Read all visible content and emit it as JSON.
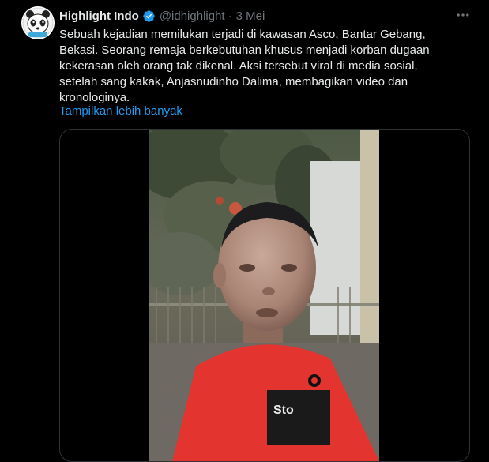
{
  "tweet": {
    "display_name": "Highlight Indo",
    "handle": "@idhighlight",
    "separator": "·",
    "date": "3 Mei",
    "text": "Sebuah kejadian memilukan terjadi di kawasan Asco, Bantar Gebang,\nBekasi. Seorang remaja berkebutuhan khusus menjadi korban dugaan\nkekerasan oleh orang tak dikenal. Aksi tersebut  viral di media sosial,\nsetelah sang kakak, Anjasnudinho Dalima, membagikan video dan\nkronologinya.",
    "show_more": "Tampilkan lebih banyak",
    "verified": true,
    "more_icon": "more-horizontal-icon",
    "media_type": "video"
  },
  "colors": {
    "background": "#000000",
    "text": "#e7e9ea",
    "secondary": "#71767b",
    "link": "#1d9bf0",
    "verified": "#1d9bf0"
  }
}
